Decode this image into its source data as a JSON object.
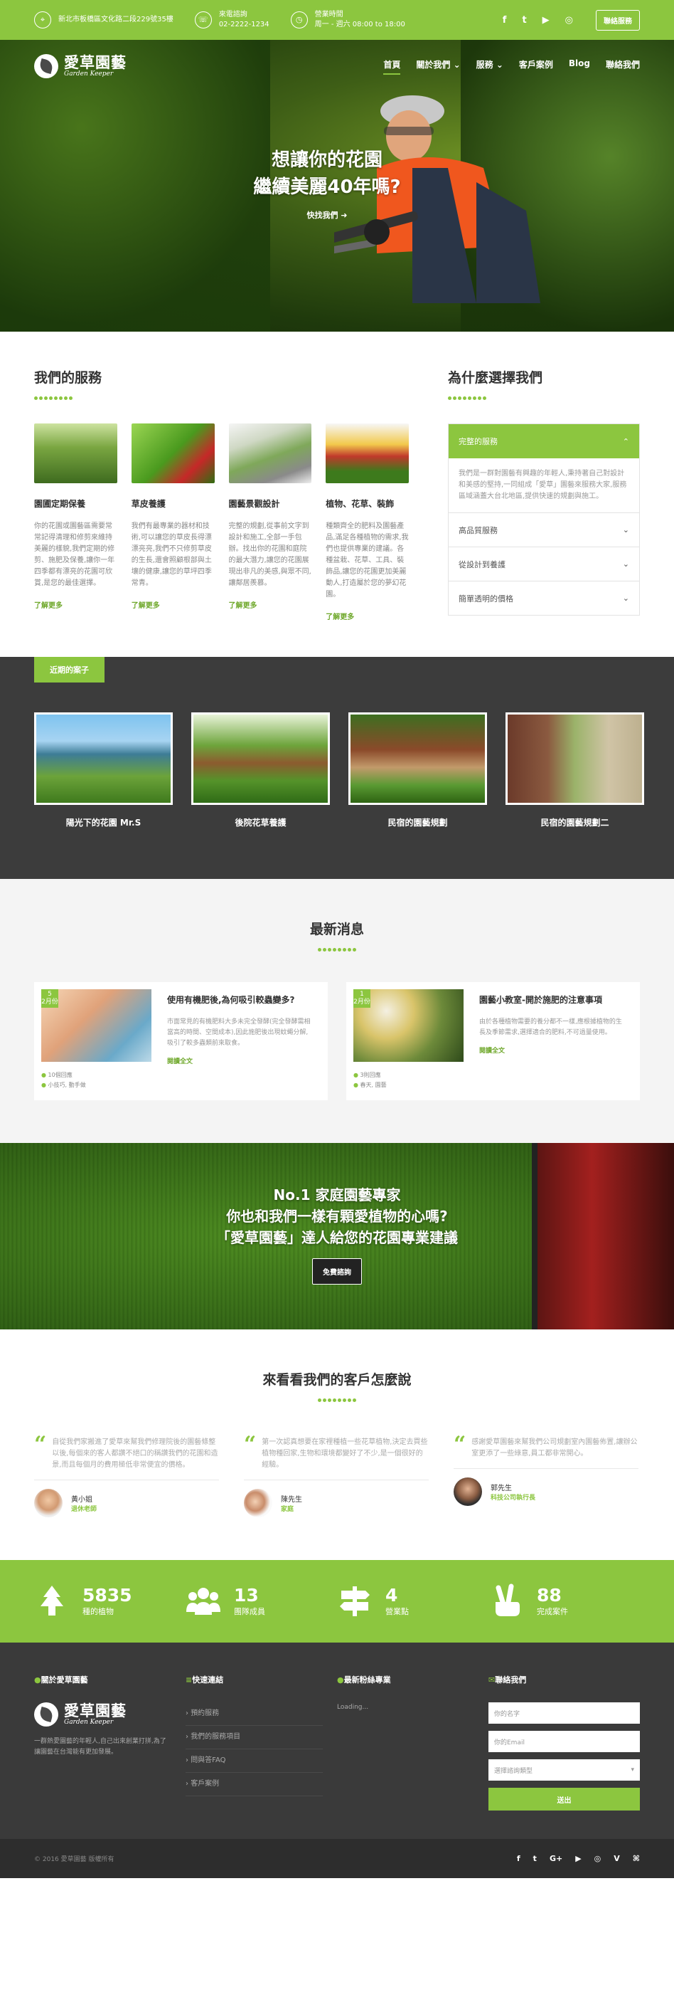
{
  "topbar": {
    "address": "新北市板橋區文化路二段229號35樓",
    "phone_label": "來電諮詢",
    "phone": "02-2222-1234",
    "hours_label": "營業時間",
    "hours": "周一 - 週六 08:00 to 18:00",
    "social": [
      "f",
      "t",
      "▶",
      "◎"
    ],
    "contact_button": "聯絡服務"
  },
  "nav": {
    "logo_title": "愛草園藝",
    "logo_subtitle": "Garden Keeper",
    "links": [
      "首頁",
      "關於我們 ⌄",
      "服務 ⌄",
      "客戶案例",
      "Blog",
      "聯絡我們"
    ]
  },
  "hero": {
    "line1": "想讓你的花園",
    "line2": "繼續美麗40年嗎?",
    "more": "快找我們 ➜"
  },
  "services": {
    "title": "我們的服務",
    "items": [
      {
        "title": "園圃定期保養",
        "text": "你的花園或園藝區需要常常記得清理和修剪來維持美麗的樣貌,我們定期的修剪、施肥及保養,讓你一年四季都有漂亮的花園可欣賞,是您的最佳選擇。",
        "more": "了解更多"
      },
      {
        "title": "草皮養護",
        "text": "我們有最專業的器材和技術,可以讓您的草皮長得漂漂亮亮,我們不只修剪草皮的生長,還會照顧根部與土壤的健康,讓您的草坪四季常青。",
        "more": "了解更多"
      },
      {
        "title": "園藝景觀設計",
        "text": "完整的規劃,從事前文字到設計和施工,全部一手包辦。找出你的花園和庭院的最大潛力,讓您的花園展現出非凡的美感,與眾不同,讓鄰居羨慕。",
        "more": "了解更多"
      },
      {
        "title": "植物、花草、裝飾",
        "text": "種類齊全的肥料及園藝產品,滿足各種植物的需求,我們也提供專業的建議。各種盆栽、花草、工具、裝飾品,讓您的花園更加美麗動人,打造屬於您的夢幻花園。",
        "more": "了解更多"
      }
    ]
  },
  "why": {
    "title": "為什麼選擇我們",
    "items": [
      {
        "title": "完整的服務",
        "body": "我們是一群對園藝有興趣的年輕人,秉持著自己對設計和美感的堅持,一同組成「愛草」園藝來服務大家,服務區域涵蓋大台北地區,提供快速的規劃與施工。"
      },
      {
        "title": "高品質服務"
      },
      {
        "title": "從設計到養護"
      },
      {
        "title": "簡單透明的價格"
      }
    ]
  },
  "cases": {
    "tab": "近期的案子",
    "items": [
      "陽光下的花園 Mr.S",
      "後院花草養護",
      "民宿的園藝規劃",
      "民宿的園藝規劃二"
    ]
  },
  "news": {
    "title": "最新消息",
    "items": [
      {
        "day": "5",
        "month": "2月份",
        "title": "使用有機肥後,為何吸引較蟲變多?",
        "text": "市面常見的有機肥料大多未完全發酵(完全發酵需相當高的時間、空間成本),因此施肥後出現蚊蠅分解,吸引了較多蟲類前來取食。",
        "comments": "10個回應",
        "tags": "小技巧, 動手做",
        "more": "閱讀全文"
      },
      {
        "day": "1",
        "month": "2月份",
        "title": "園藝小教室-開於施肥的注意事項",
        "text": "由於各種植物需要的養分都不一樣,應根據植物的生長及季節需求,選擇適合的肥料,不可過量使用。",
        "comments": "3則回應",
        "tags": "春天, 園藝",
        "more": "閱讀全文"
      }
    ]
  },
  "banner": {
    "line1": "No.1 家庭園藝專家",
    "line2": "你也和我們一樣有顆愛植物的心嗎?",
    "line3": "「愛草園藝」達人給您的花園專業建議",
    "button": "免費諮詢"
  },
  "testimonials": {
    "title": "來看看我們的客戶怎麼說",
    "items": [
      {
        "quote": "自從我們家搬進了愛草來幫我們修理院後的園藝條整以後,每個來的客人都讚不絕口的稱讚我們的花園和造景,而且每個月的費用極低非常便宜的價格。",
        "name": "黃小姐",
        "role": "退休老師"
      },
      {
        "quote": "第一次認真想要在家裡種植一些花草植物,決定去買些植物種回家,生物和環境都變好了不少,是一個很好的經驗。",
        "name": "陳先生",
        "role": "家庭"
      },
      {
        "quote": "感謝愛草園藝來幫我們公司規劃室內園藝佈置,讓辦公室更添了一些綠意,員工都非常開心。",
        "name": "郭先生",
        "role": "科技公司執行長"
      }
    ]
  },
  "stats": [
    {
      "num": "5835",
      "label": "種的植物"
    },
    {
      "num": "13",
      "label": "團隊成員"
    },
    {
      "num": "4",
      "label": "營業點"
    },
    {
      "num": "88",
      "label": "完成案件"
    }
  ],
  "footer": {
    "about_head": "關於愛草園藝",
    "about_text": "一群熱愛園藝的年輕人,自己出來創業打拼,為了讓園藝在台灣能有更加發展。",
    "links_head": "快速連結",
    "links": [
      "預約服務",
      "我們的服務項目",
      "問與答FAQ",
      "客戶案例"
    ],
    "twitter_head": "最新粉絲專業",
    "twitter_text": "Loading...",
    "contact_head": "聯絡我們",
    "name_placeholder": "你的名字",
    "email_placeholder": "你的Email",
    "select_text": "選擇諮詢類型",
    "submit": "送出"
  },
  "copyright": {
    "text": "© 2016 愛草園藝 版權所有",
    "social": [
      "f",
      "t",
      "G+",
      "▶",
      "◎",
      "V",
      "⌘"
    ]
  }
}
